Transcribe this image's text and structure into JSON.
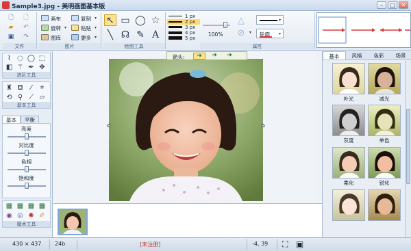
{
  "window": {
    "title": "Sample3.jpg - 美明画图基本版",
    "buttons": {
      "minimize": "–",
      "maximize": "□",
      "close": "✕"
    }
  },
  "ribbon": {
    "groups": [
      {
        "id": "file",
        "label": "文件"
      },
      {
        "id": "image",
        "label": "图片"
      },
      {
        "id": "shapes",
        "label": "绘图工具"
      },
      {
        "id": "props",
        "label": "属性"
      }
    ],
    "image_commands": {
      "canvas": "画布",
      "copy": "复制",
      "rotate": "旋转",
      "paste": "粘贴",
      "image": "图库",
      "more": "更多"
    },
    "line_widths": [
      "1 px",
      "2 px",
      "3 px",
      "4 px",
      "5 px"
    ],
    "selected_line_width": "2 px",
    "opacity": "100%",
    "outline_label": "轮廓",
    "arrow_label": "箭头:"
  },
  "left_panel": {
    "sections": {
      "select": "选区工具",
      "basic": "基本工具",
      "magic": "魔术工具"
    },
    "tabs": [
      "基本",
      "平衡"
    ],
    "active_tab": "基本",
    "adjustments": [
      {
        "label": "亮度",
        "value": 0.5
      },
      {
        "label": "对比度",
        "value": 0.5
      },
      {
        "label": "色相",
        "value": 0.5
      },
      {
        "label": "饱和度",
        "value": 0.5
      }
    ]
  },
  "right_panel": {
    "tabs": [
      "基本",
      "风格",
      "色彩",
      "场景"
    ],
    "active_tab": "基本",
    "effects": [
      "补光",
      "减光",
      "灰度",
      "单色",
      "柔化",
      "锐化",
      "",
      ""
    ]
  },
  "status": {
    "dimensions": "430 × 437",
    "bit_depth": "24b",
    "registration": "[未注册]",
    "coords": "-4, 39"
  },
  "colors": {
    "accent_red": "#d83a3a",
    "selection_yellow": "#ffe38a",
    "registration_red": "#c0392b"
  }
}
